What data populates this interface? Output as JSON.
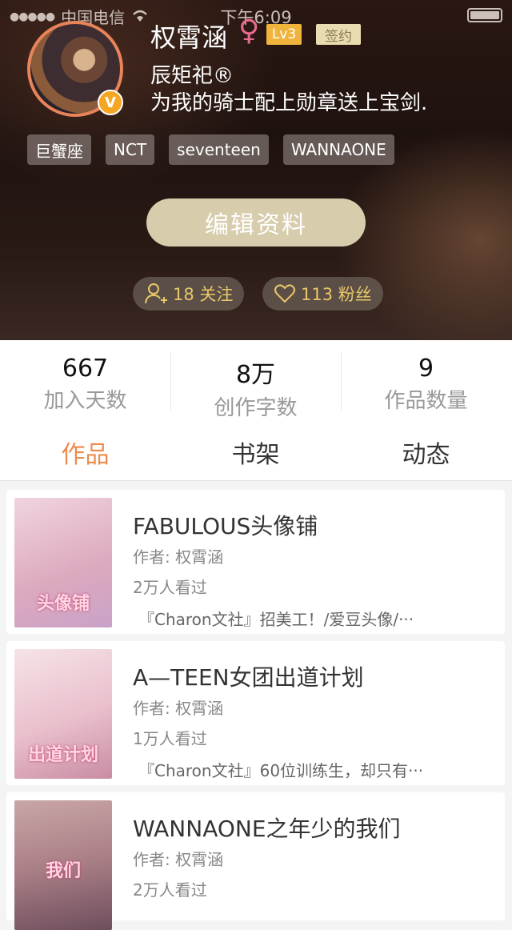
{
  "status": {
    "carrier": "中国电信",
    "time": "下午6:09"
  },
  "profile": {
    "name": "权霄涵",
    "gender_symbol": "♀",
    "level": "Lv3",
    "sign": "签约",
    "verified_badge": "V",
    "line1": "辰矩祀®",
    "line2": "为我的骑士配上勋章送上宝剑.",
    "tags": [
      "巨蟹座",
      "NCT",
      "seventeen",
      "WANNAONE"
    ],
    "edit_button": "编辑资料",
    "follow": "18 关注",
    "fans": "113 粉丝"
  },
  "stats": [
    {
      "value": "667",
      "label": "加入天数"
    },
    {
      "value": "8万",
      "label": "创作字数"
    },
    {
      "value": "9",
      "label": "作品数量"
    }
  ],
  "tabs": [
    "作品",
    "书架",
    "动态"
  ],
  "works": [
    {
      "title": "FABULOUS头像铺",
      "author": "作者: 权霄涵",
      "views": "2万人看过",
      "desc": "『Charon文社』招美工！/爱豆头像/···",
      "cover_text": "头像铺",
      "cover_color": "#e9c6d6"
    },
    {
      "title": "A—TEEN女团出道计划",
      "author": "作者: 权霄涵",
      "views": "1万人看过",
      "desc": "『Charon文社』60位训练生，却只有···",
      "cover_text": "出道计划",
      "cover_color": "#f2d8df"
    },
    {
      "title": "WANNAONE之年少的我们",
      "author": "作者: 权霄涵",
      "views": "2万人看过",
      "desc": "",
      "cover_text": "我们",
      "cover_color": "#b98d8f"
    }
  ],
  "icons": {
    "wifi": "wifi-icon",
    "battery": "battery-icon",
    "follow": "person-add-icon",
    "fans": "heart-icon"
  }
}
